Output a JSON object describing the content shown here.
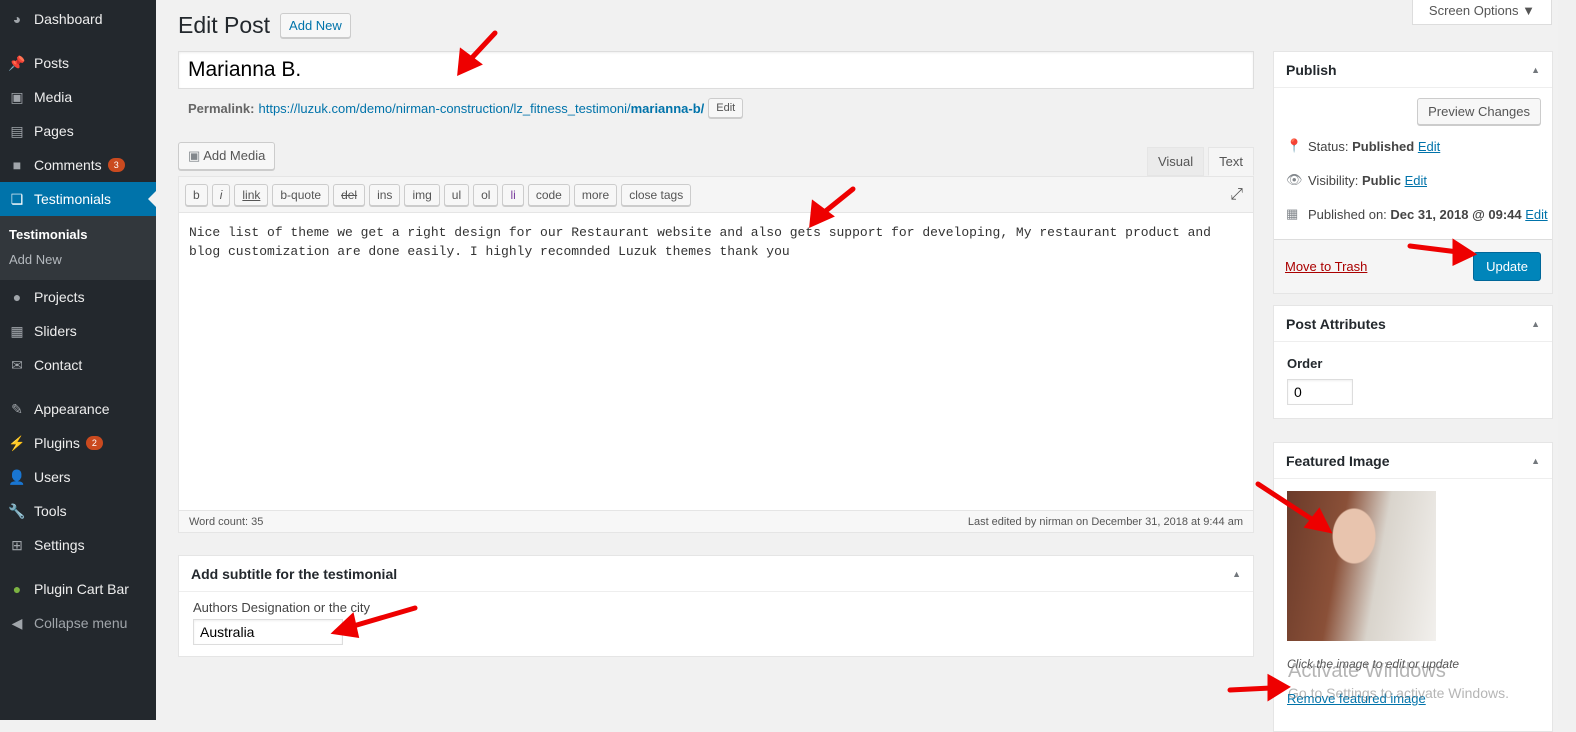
{
  "sidebar": {
    "items": [
      {
        "label": "Dashboard",
        "icon": "dashboard-icon"
      },
      {
        "label": "Posts",
        "icon": "pin-icon"
      },
      {
        "label": "Media",
        "icon": "media-icon"
      },
      {
        "label": "Pages",
        "icon": "pages-icon"
      },
      {
        "label": "Comments",
        "icon": "comment-icon",
        "badge": "3"
      },
      {
        "label": "Testimonials",
        "icon": "testimonial-icon"
      },
      {
        "label": "Projects",
        "icon": "projects-icon"
      },
      {
        "label": "Sliders",
        "icon": "sliders-icon"
      },
      {
        "label": "Contact",
        "icon": "mail-icon"
      },
      {
        "label": "Appearance",
        "icon": "brush-icon"
      },
      {
        "label": "Plugins",
        "icon": "plugin-icon",
        "badge": "2"
      },
      {
        "label": "Users",
        "icon": "user-icon"
      },
      {
        "label": "Tools",
        "icon": "wrench-icon"
      },
      {
        "label": "Settings",
        "icon": "settings-icon"
      },
      {
        "label": "Plugin Cart Bar",
        "icon": "leaf-icon"
      },
      {
        "label": "Collapse menu",
        "icon": "collapse-icon"
      }
    ],
    "submenu": [
      "Testimonials",
      "Add New"
    ]
  },
  "header": {
    "title": "Edit Post",
    "add_new": "Add New",
    "screen_options": "Screen Options ▼"
  },
  "post": {
    "title": "Marianna B.",
    "permalink_label": "Permalink:",
    "permalink_url": "https://luzuk.com/demo/nirman-construction/lz_fitness_testimoni/",
    "permalink_slug": "marianna-b/",
    "edit": "Edit"
  },
  "editor": {
    "add_media": "Add Media",
    "tabs": [
      "Visual",
      "Text"
    ],
    "active_tab": "Text",
    "quicktags": [
      "b",
      "i",
      "link",
      "b-quote",
      "del",
      "ins",
      "img",
      "ul",
      "ol",
      "li",
      "code",
      "more",
      "close tags"
    ],
    "content": "Nice list of theme we get a right design for our Restaurant website and also gets support for developing, My restaurant product and blog customization are done easily. I highly recomnded Luzuk themes thank you",
    "word_count": "Word count: 35",
    "last_edited": "Last edited by nirman on December 31, 2018 at 9:44 am"
  },
  "subtitle_box": {
    "title": "Add subtitle for the testimonial",
    "label": "Authors Designation or the city",
    "value": "Australia"
  },
  "publish": {
    "title": "Publish",
    "preview": "Preview Changes",
    "status_label": "Status:",
    "status": "Published",
    "visibility_label": "Visibility:",
    "visibility": "Public",
    "published_label": "Published on:",
    "published": "Dec 31, 2018 @ 09:44",
    "edit": "Edit",
    "trash": "Move to Trash",
    "update": "Update"
  },
  "attributes": {
    "title": "Post Attributes",
    "order_label": "Order",
    "order": "0"
  },
  "featured": {
    "title": "Featured Image",
    "hint": "Click the image to edit or update",
    "remove": "Remove featured image"
  },
  "watermark": {
    "line1": "Activate Windows",
    "line2": "Go to Settings to activate Windows."
  },
  "colors": {
    "sidebar": "#23282d",
    "accent": "#0073aa",
    "update": "#0085ba",
    "badge": "#ca4a1f",
    "arrow": "#e00000"
  }
}
